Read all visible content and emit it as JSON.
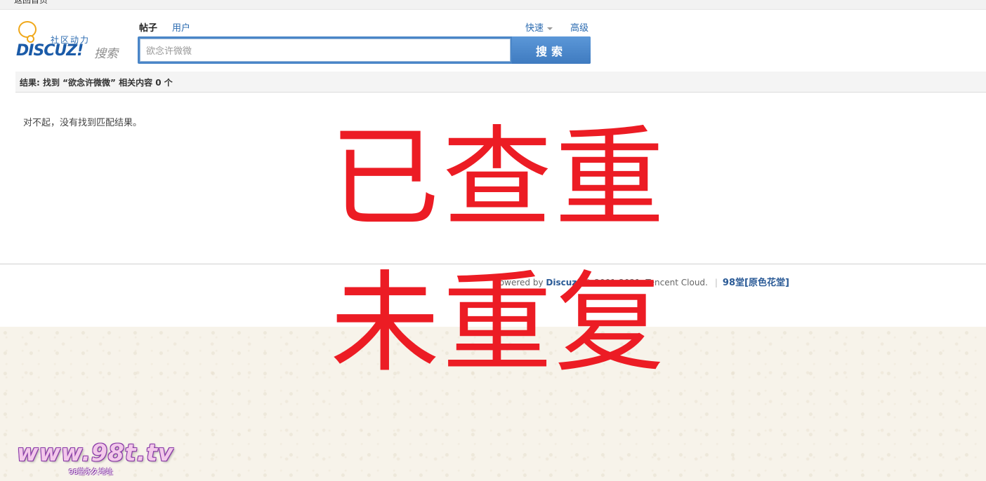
{
  "topbar": {
    "text": "返回首页"
  },
  "logo": {
    "slogan": "社区动力",
    "brand": "DISCUZ!",
    "brand_search": "搜索"
  },
  "tabs": [
    {
      "label": "帖子",
      "active": true
    },
    {
      "label": "用户",
      "active": false
    }
  ],
  "quick_label": "快速",
  "advanced_label": "高级",
  "search": {
    "value": "欲念许微微",
    "button_label": "搜索"
  },
  "result": {
    "summary": "结果: 找到 “欲念许微微” 相关内容 0 个"
  },
  "no_result_message": "对不起，没有找到匹配结果。",
  "footer": {
    "powered_prefix": "Powered by ",
    "powered_brand": "Discuz!",
    "copyright": " © 2001-2021, Tencent Cloud.",
    "separator": "|",
    "site_link": "98堂[原色花堂]"
  },
  "stamp": {
    "line1": "已查重",
    "line2": "未重复"
  },
  "watermark": {
    "url": "www.98t.tv",
    "sub": "98堂永久地址"
  },
  "colors": {
    "accent": "#4a86c8",
    "link": "#2a6ab0",
    "stamp": "#ec1c24",
    "beige_bg": "#f7f3ea"
  }
}
